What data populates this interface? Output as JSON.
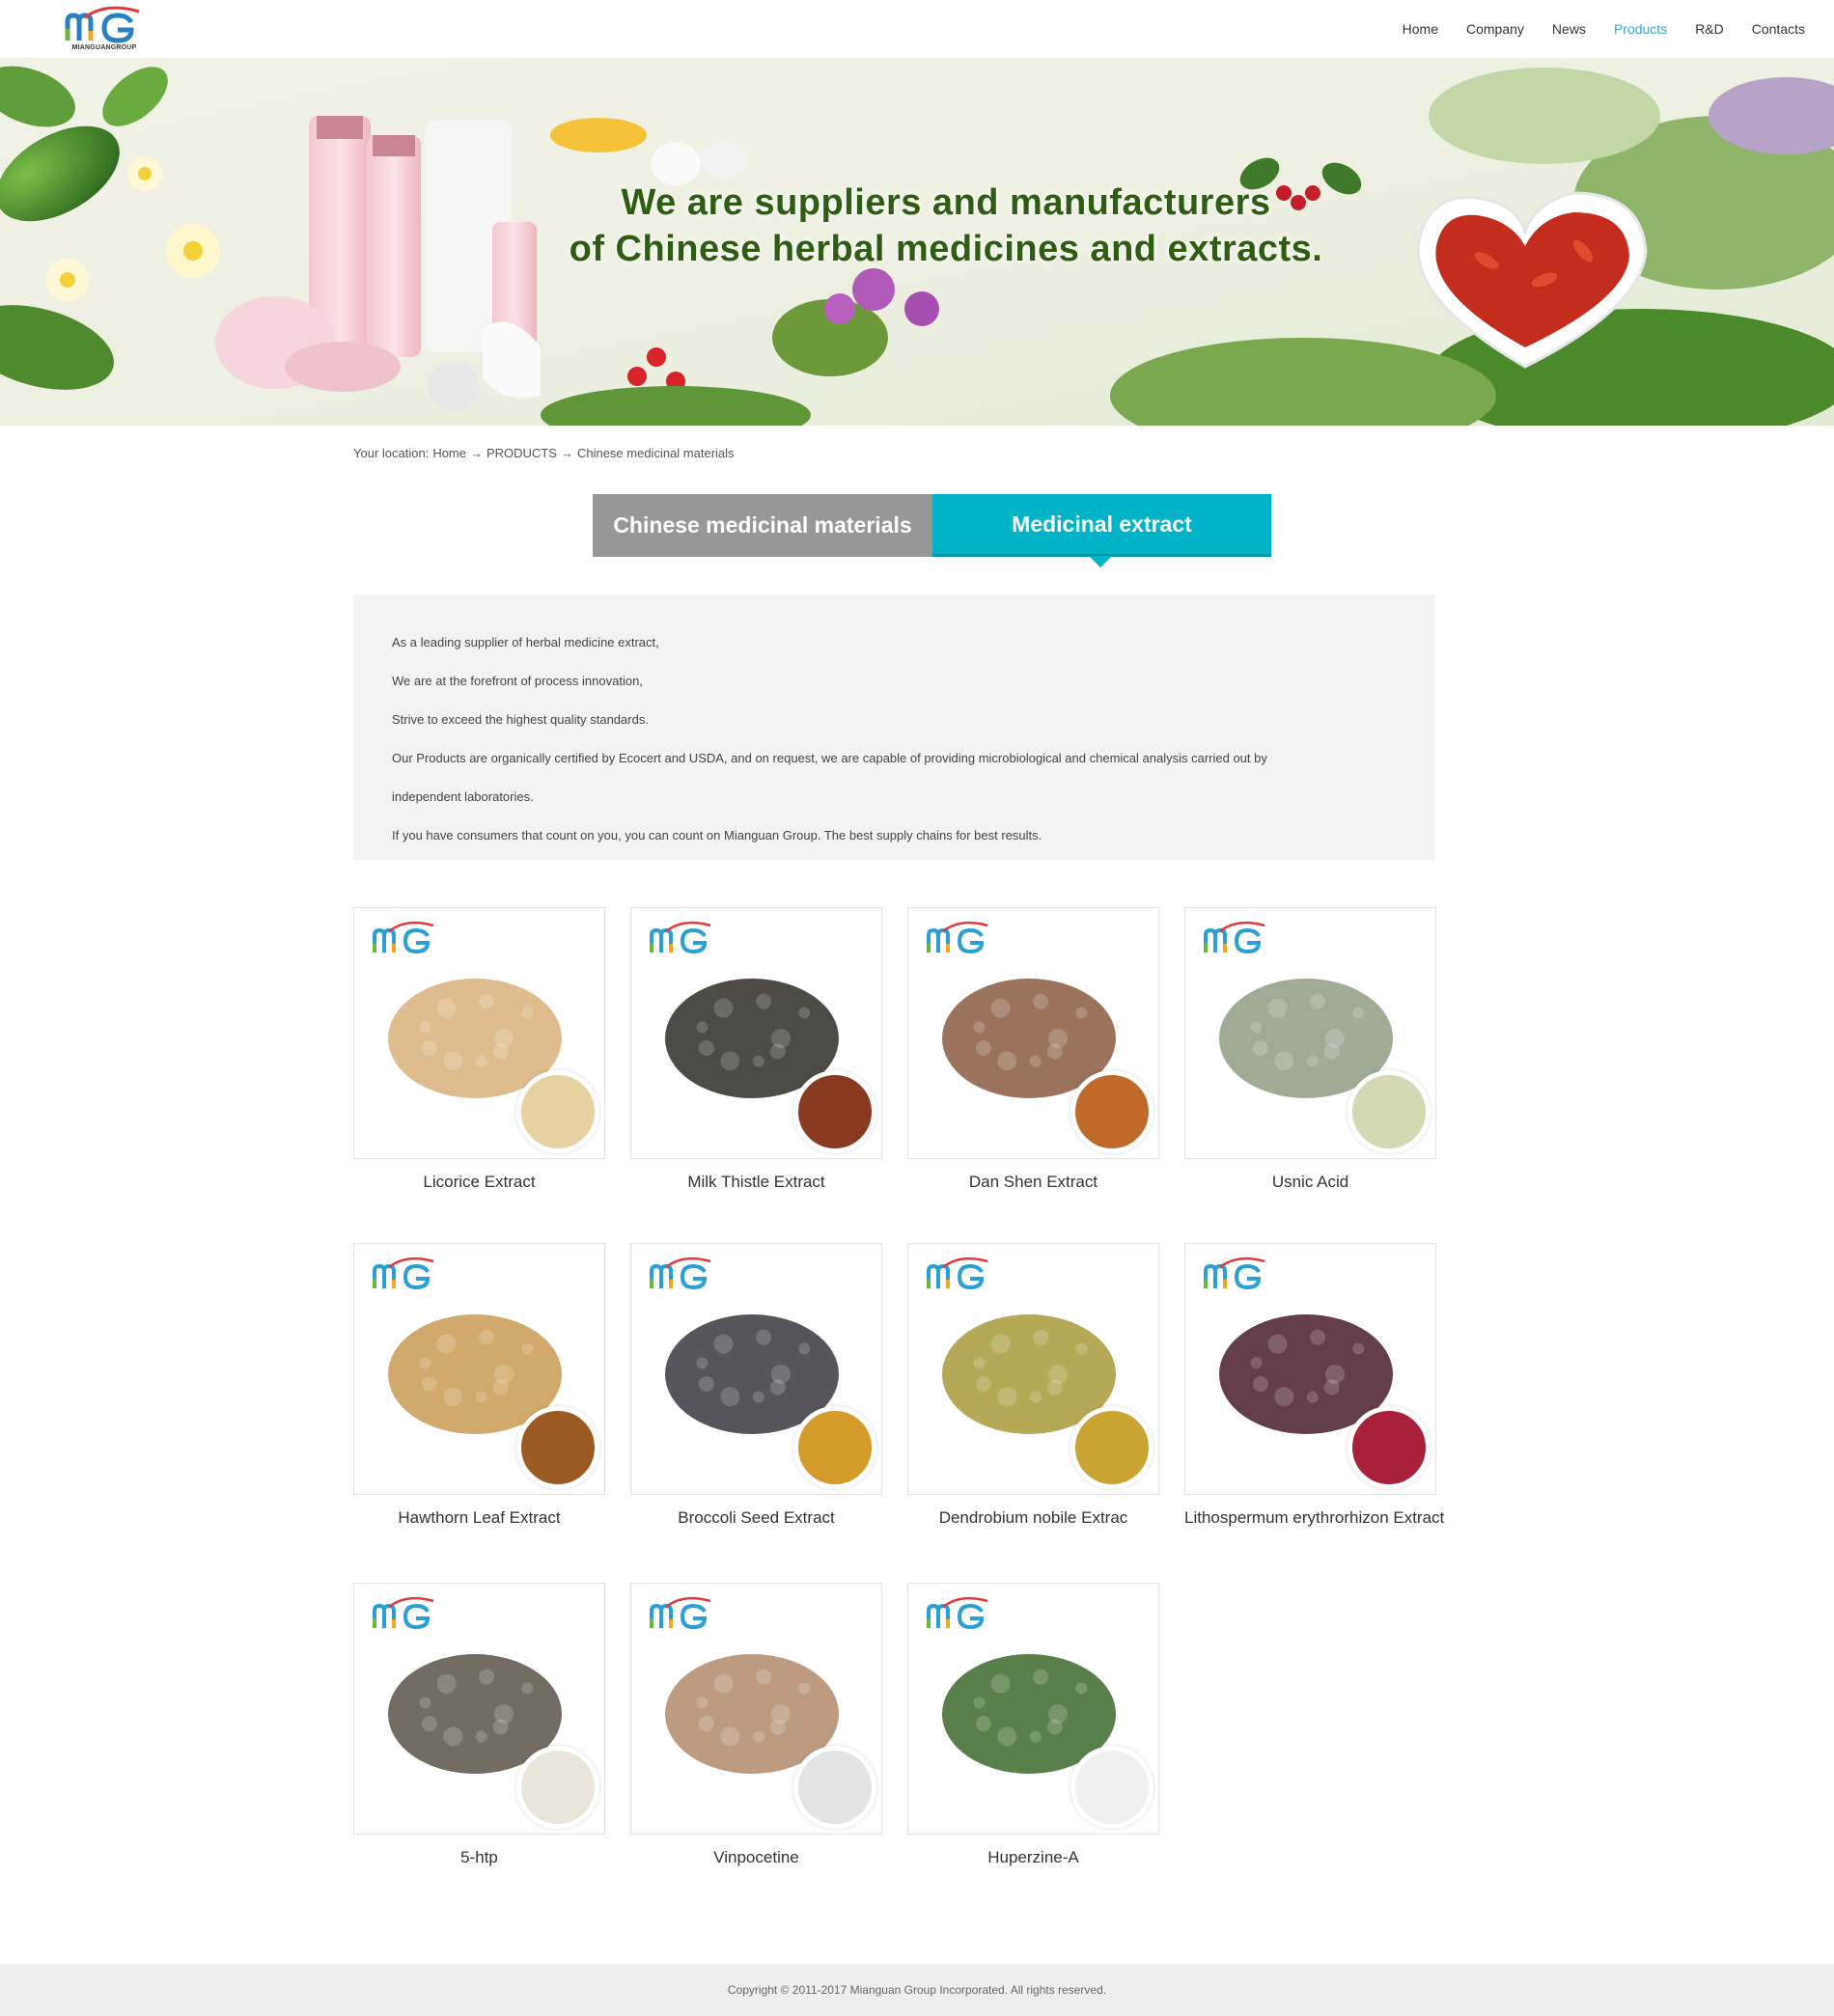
{
  "header": {
    "logo_text": "MIANGUANGROUP",
    "nav": [
      {
        "label": "Home",
        "active": false
      },
      {
        "label": "Company",
        "active": false
      },
      {
        "label": "News",
        "active": false
      },
      {
        "label": "Products",
        "active": true
      },
      {
        "label": "R&D",
        "active": false
      },
      {
        "label": "Contacts",
        "active": false
      }
    ],
    "accent_color": "#2eabd6"
  },
  "banner": {
    "line1": "We are suppliers and manufacturers",
    "line2": "of Chinese herbal medicines and extracts."
  },
  "breadcrumb": {
    "prefix": "Your location:",
    "items": [
      "Home",
      "PRODUCTS",
      "Chinese medicinal materials"
    ],
    "separator": "→"
  },
  "tabs": [
    {
      "label": "Chinese medicinal materials",
      "active": false,
      "color": "#979797"
    },
    {
      "label": "Medicinal extract",
      "active": true,
      "color": "#00b3c7"
    }
  ],
  "intro": {
    "lines": [
      "As a leading supplier of herbal medicine extract,",
      "We are at the forefront of process innovation,",
      "Strive to exceed the highest quality standards.",
      "Our Products are organically certified by Ecocert and USDA, and on request, we are capable of providing microbiological and chemical analysis carried out by",
      "independent laboratories.",
      "If you have consumers that count on you, you can count on Mianguan Group. The best supply chains for best results."
    ]
  },
  "products": [
    {
      "name": "Licorice Extract",
      "herb_color": "#d9b07a",
      "powder_color": "#e6d2a1",
      "herb_icon": "licorice-slices"
    },
    {
      "name": "Milk Thistle Extract",
      "herb_color": "#2f2a24",
      "powder_color": "#8b3a22",
      "herb_icon": "milk-thistle-seeds"
    },
    {
      "name": "Dan Shen Extract",
      "herb_color": "#8a5a40",
      "powder_color": "#c06a2a",
      "herb_icon": "dan-shen-root"
    },
    {
      "name": "Usnic Acid",
      "herb_color": "#8f9c84",
      "powder_color": "#d6d8b4",
      "herb_icon": "usnea-lichen"
    },
    {
      "name": "Hawthorn Leaf Extract",
      "herb_color": "#c99a52",
      "powder_color": "#9a5a22",
      "herb_icon": "hawthorn-leaves"
    },
    {
      "name": "Broccoli Seed Extract",
      "herb_color": "#3b3640",
      "powder_color": "#d49a2a",
      "herb_icon": "broccoli-seeds"
    },
    {
      "name": "Dendrobium nobile Extrac",
      "herb_color": "#a89a3a",
      "powder_color": "#c9a433",
      "herb_icon": "dendrobium-coils"
    },
    {
      "name": "Lithospermum erythrorhizon Extract",
      "herb_color": "#4a1c2c",
      "powder_color": "#a8203a",
      "herb_icon": "lithospermum-root"
    },
    {
      "name": "5-htp",
      "herb_color": "#5a5248",
      "powder_color": "#ebe6dc",
      "herb_icon": "griffonia-seeds"
    },
    {
      "name": "Vinpocetine",
      "herb_color": "#b08a6a",
      "powder_color": "#e4e4e4",
      "herb_icon": "vinca-seeds"
    },
    {
      "name": "Huperzine-A",
      "herb_color": "#3c6a2a",
      "powder_color": "#f0f0f0",
      "herb_icon": "huperzia-plant"
    }
  ],
  "footer": {
    "copyright": "Copyright © 2011-2017 Mianguan Group Incorporated. All rights reserved."
  }
}
